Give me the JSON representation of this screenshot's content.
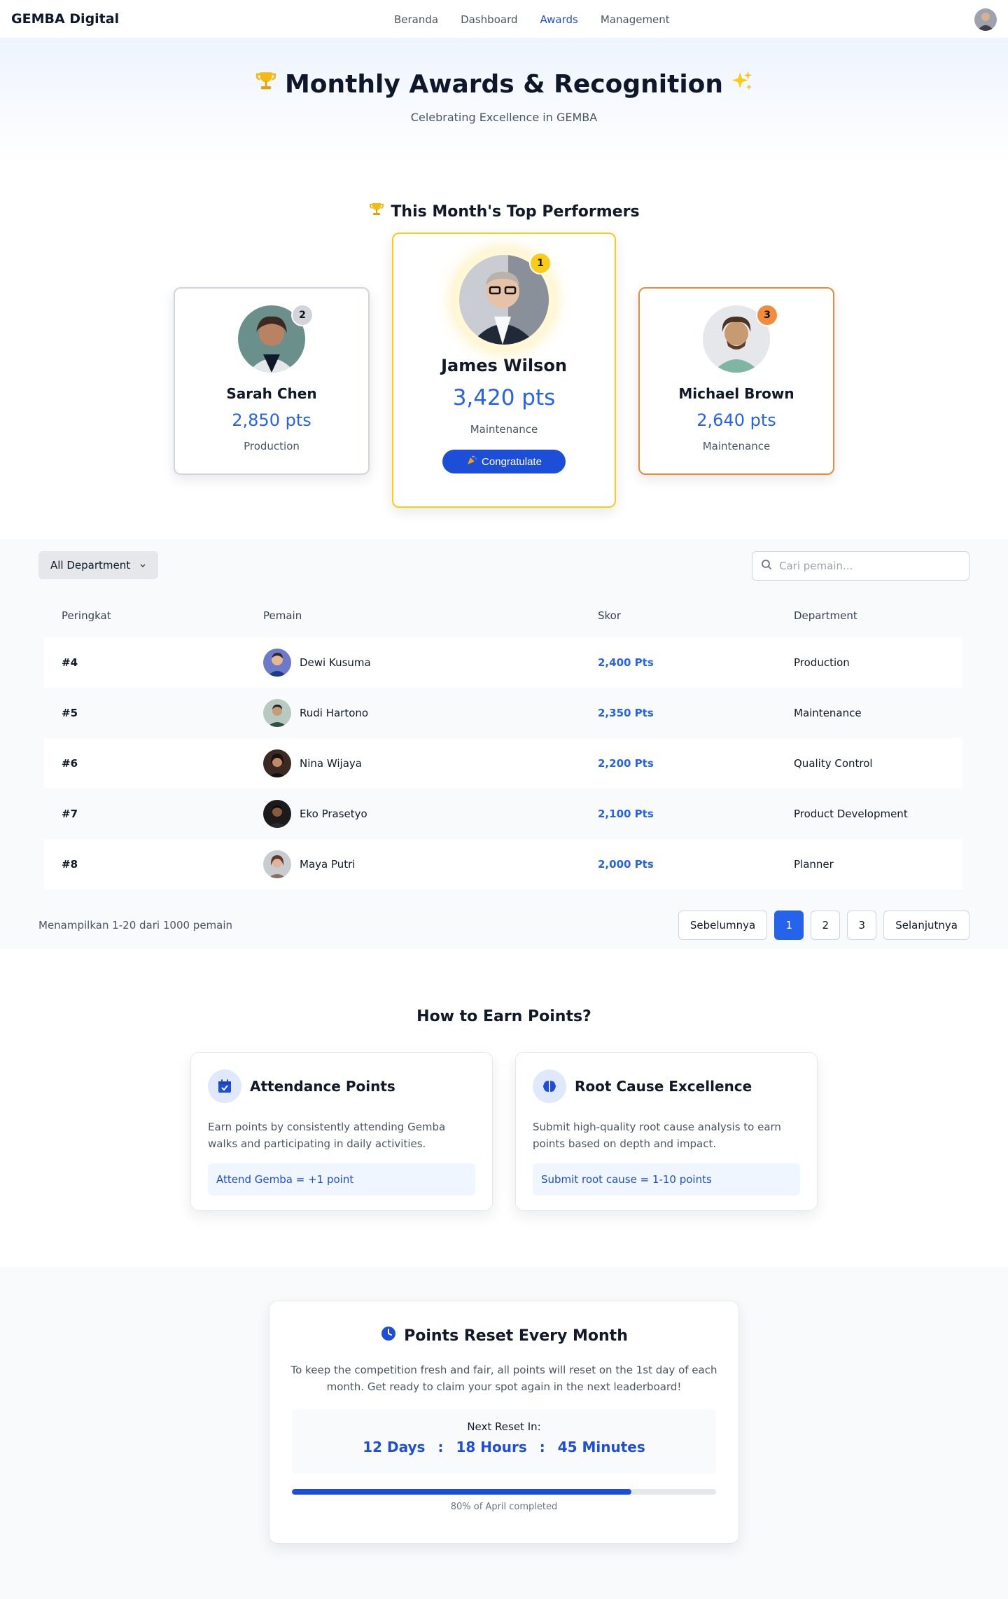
{
  "nav": {
    "brand": "GEMBA Digital",
    "links": [
      "Beranda",
      "Dashboard",
      "Awards",
      "Management"
    ],
    "active": "Awards"
  },
  "hero": {
    "title": "Monthly Awards & Recognition",
    "subtitle": "Celebrating Excellence in GEMBA"
  },
  "top": {
    "title": "This Month's Top Performers",
    "performers": [
      {
        "rank": "1",
        "name": "James Wilson",
        "points": "3,420 pts",
        "dept": "Maintenance"
      },
      {
        "rank": "2",
        "name": "Sarah Chen",
        "points": "2,850 pts",
        "dept": "Production"
      },
      {
        "rank": "3",
        "name": "Michael Brown",
        "points": "2,640 pts",
        "dept": "Maintenance"
      }
    ],
    "congratulate": "Congratulate"
  },
  "board": {
    "filter": "All Department",
    "search_placeholder": "Cari pemain...",
    "headers": [
      "Peringkat",
      "Pemain",
      "Skor",
      "Department"
    ],
    "rows": [
      {
        "rank": "#4",
        "name": "Dewi Kusuma",
        "score": "2,400 Pts",
        "dept": "Production"
      },
      {
        "rank": "#5",
        "name": "Rudi Hartono",
        "score": "2,350 Pts",
        "dept": "Maintenance"
      },
      {
        "rank": "#6",
        "name": "Nina Wijaya",
        "score": "2,200 Pts",
        "dept": "Quality Control"
      },
      {
        "rank": "#7",
        "name": "Eko Prasetyo",
        "score": "2,100 Pts",
        "dept": "Product Development"
      },
      {
        "rank": "#8",
        "name": "Maya Putri",
        "score": "2,000 Pts",
        "dept": "Planner"
      }
    ],
    "showing": "Menampilkan 1-20 dari 1000 pemain",
    "prev": "Sebelumnya",
    "pages": [
      "1",
      "2",
      "3"
    ],
    "next": "Selanjutnya"
  },
  "earn": {
    "title": "How to Earn Points?",
    "cards": [
      {
        "title": "Attendance Points",
        "desc": "Earn points by consistently attending Gemba walks and participating in daily activities.",
        "chip": "Attend Gemba = +1 point",
        "icon": "calendar-check-icon"
      },
      {
        "title": "Root Cause Excellence",
        "desc": "Submit high-quality root cause analysis to earn points based on depth and impact.",
        "chip": "Submit root cause = 1-10 points",
        "icon": "brain-icon"
      }
    ]
  },
  "reset": {
    "title": "Points Reset Every Month",
    "desc": "To keep the competition fresh and fair, all points will reset on the 1st day of each month. Get ready to claim your spot again in the next leaderboard!",
    "next_label": "Next Reset In:",
    "days": "12 Days",
    "hours": "18 Hours",
    "minutes": "45 Minutes",
    "sep": ":",
    "progress_fraction": 0.8,
    "progress_label": "80% of April completed"
  },
  "colors": {
    "accent": "#2563eb",
    "gold": "#facc15",
    "silver": "#d1d5db",
    "bronze": "#ea8a3a"
  }
}
